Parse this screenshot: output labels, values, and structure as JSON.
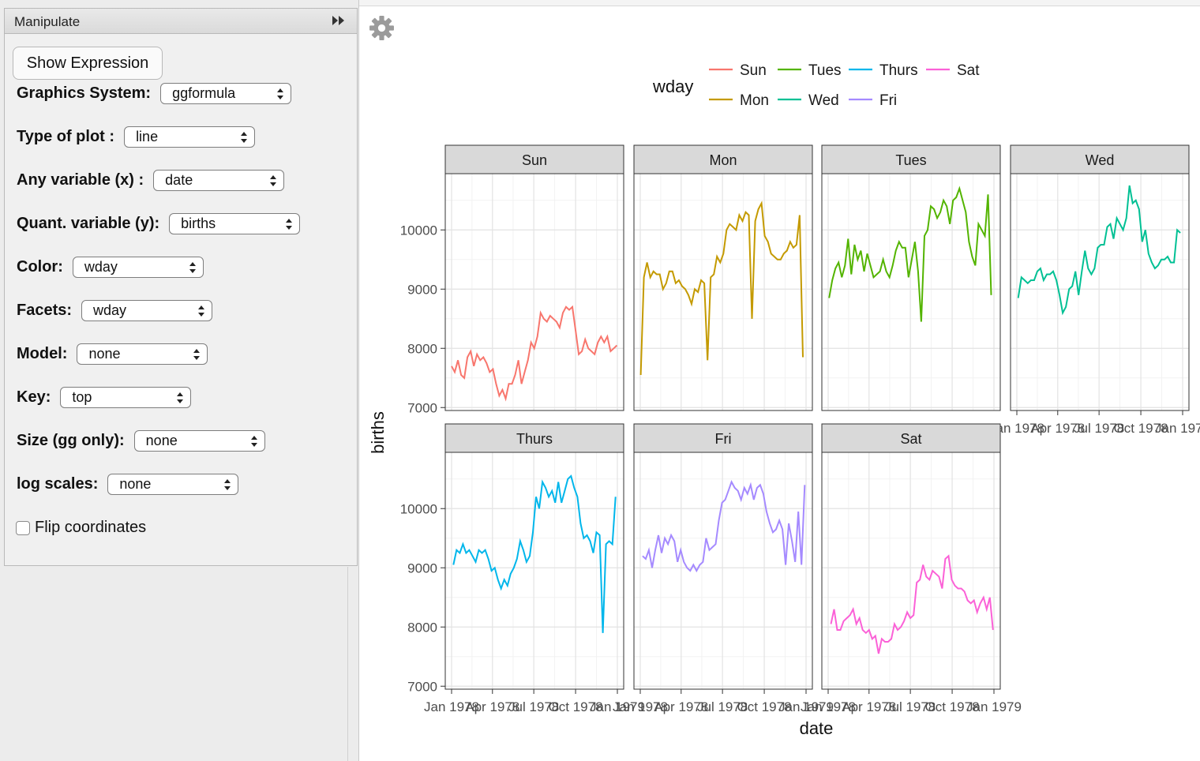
{
  "window": {
    "panel_title": "Manipulate"
  },
  "controls": {
    "show_expression_label": "Show Expression",
    "fields": [
      {
        "label": "Graphics System:",
        "value": "ggformula"
      },
      {
        "label": "Type of plot :",
        "value": "line"
      },
      {
        "label": "Any variable (x) :",
        "value": "date"
      },
      {
        "label": "Quant. variable (y):",
        "value": "births"
      },
      {
        "label": "Color:",
        "value": "wday"
      },
      {
        "label": "Facets:",
        "value": "wday"
      },
      {
        "label": "Model:",
        "value": "none"
      },
      {
        "label": "Key:",
        "value": "top"
      },
      {
        "label": "Size (gg only):",
        "value": "none"
      },
      {
        "label": "log scales:",
        "value": "none"
      }
    ],
    "flip_coordinates": {
      "label": "Flip coordinates",
      "checked": false
    }
  },
  "icons": {
    "settings": "gear-icon",
    "collapse": "double-chevron-right-icon"
  },
  "chart_data": {
    "type": "line",
    "facet_by": "wday",
    "facet_ncol": 4,
    "xlabel": "date",
    "ylabel": "births",
    "ylim": [
      6950,
      10950
    ],
    "yticks": [
      7000,
      8000,
      9000,
      10000
    ],
    "xlim": [
      "1978-01-01",
      "1979-01-01"
    ],
    "xticks": [
      {
        "date": "1978-01-01",
        "label": "Jan 1978"
      },
      {
        "date": "1978-04-01",
        "label": "Apr 1978"
      },
      {
        "date": "1978-07-01",
        "label": "Jul 1978"
      },
      {
        "date": "1978-10-01",
        "label": "Oct 1978"
      },
      {
        "date": "1979-01-01",
        "label": "Jan 1979"
      }
    ],
    "legend": {
      "title": "wday",
      "position": "top"
    },
    "grid": true,
    "series": [
      {
        "name": "Sun",
        "color": "#F8766D",
        "x": [
          "1978-01-01",
          "1978-01-08",
          "1978-01-15",
          "1978-01-22",
          "1978-01-29",
          "1978-02-05",
          "1978-02-12",
          "1978-02-19",
          "1978-02-26",
          "1978-03-05",
          "1978-03-12",
          "1978-03-19",
          "1978-03-26",
          "1978-04-02",
          "1978-04-09",
          "1978-04-16",
          "1978-04-23",
          "1978-04-30",
          "1978-05-07",
          "1978-05-14",
          "1978-05-21",
          "1978-05-28",
          "1978-06-04",
          "1978-06-11",
          "1978-06-18",
          "1978-06-25",
          "1978-07-02",
          "1978-07-09",
          "1978-07-16",
          "1978-07-23",
          "1978-07-30",
          "1978-08-06",
          "1978-08-13",
          "1978-08-20",
          "1978-08-27",
          "1978-09-03",
          "1978-09-10",
          "1978-09-17",
          "1978-09-24",
          "1978-10-01",
          "1978-10-08",
          "1978-10-15",
          "1978-10-22",
          "1978-10-29",
          "1978-11-05",
          "1978-11-12",
          "1978-11-19",
          "1978-11-26",
          "1978-12-03",
          "1978-12-10",
          "1978-12-17",
          "1978-12-24",
          "1978-12-31"
        ],
        "y": [
          7700,
          7600,
          7800,
          7550,
          7500,
          7850,
          7950,
          7700,
          7900,
          7800,
          7850,
          7750,
          7600,
          7650,
          7400,
          7200,
          7300,
          7150,
          7400,
          7400,
          7550,
          7800,
          7400,
          7600,
          7800,
          8100,
          8000,
          8200,
          8600,
          8500,
          8450,
          8550,
          8500,
          8450,
          8350,
          8600,
          8700,
          8650,
          8700,
          8300,
          7900,
          7950,
          8150,
          8000,
          7950,
          7900,
          8100,
          8200,
          8100,
          8200,
          7950,
          8000,
          8050
        ]
      },
      {
        "name": "Mon",
        "color": "#C49A00",
        "x": [
          "1978-01-02",
          "1978-01-09",
          "1978-01-16",
          "1978-01-23",
          "1978-01-30",
          "1978-02-06",
          "1978-02-13",
          "1978-02-20",
          "1978-02-27",
          "1978-03-06",
          "1978-03-13",
          "1978-03-20",
          "1978-03-27",
          "1978-04-03",
          "1978-04-10",
          "1978-04-17",
          "1978-04-24",
          "1978-05-01",
          "1978-05-08",
          "1978-05-15",
          "1978-05-22",
          "1978-05-29",
          "1978-06-05",
          "1978-06-12",
          "1978-06-19",
          "1978-06-26",
          "1978-07-03",
          "1978-07-10",
          "1978-07-17",
          "1978-07-24",
          "1978-07-31",
          "1978-08-07",
          "1978-08-14",
          "1978-08-21",
          "1978-08-28",
          "1978-09-04",
          "1978-09-11",
          "1978-09-18",
          "1978-09-25",
          "1978-10-02",
          "1978-10-09",
          "1978-10-16",
          "1978-10-23",
          "1978-10-30",
          "1978-11-06",
          "1978-11-13",
          "1978-11-20",
          "1978-11-27",
          "1978-12-04",
          "1978-12-11",
          "1978-12-18",
          "1978-12-25"
        ],
        "y": [
          7550,
          9200,
          9450,
          9200,
          9300,
          9250,
          9250,
          9000,
          9100,
          9300,
          9300,
          9100,
          9150,
          9050,
          9000,
          8900,
          8750,
          9000,
          8950,
          9150,
          9100,
          7800,
          9200,
          9250,
          9550,
          9450,
          9600,
          10000,
          10100,
          10050,
          10000,
          10250,
          10150,
          10300,
          10250,
          8500,
          10150,
          10350,
          10450,
          9900,
          9800,
          9600,
          9550,
          9500,
          9500,
          9600,
          9650,
          9800,
          9700,
          9750,
          10250,
          7850
        ]
      },
      {
        "name": "Tues",
        "color": "#53B400",
        "x": [
          "1978-01-03",
          "1978-01-10",
          "1978-01-17",
          "1978-01-24",
          "1978-01-31",
          "1978-02-07",
          "1978-02-14",
          "1978-02-21",
          "1978-02-28",
          "1978-03-07",
          "1978-03-14",
          "1978-03-21",
          "1978-03-28",
          "1978-04-04",
          "1978-04-11",
          "1978-04-18",
          "1978-04-25",
          "1978-05-02",
          "1978-05-09",
          "1978-05-16",
          "1978-05-23",
          "1978-05-30",
          "1978-06-06",
          "1978-06-13",
          "1978-06-20",
          "1978-06-27",
          "1978-07-04",
          "1978-07-11",
          "1978-07-18",
          "1978-07-25",
          "1978-08-01",
          "1978-08-08",
          "1978-08-15",
          "1978-08-22",
          "1978-08-29",
          "1978-09-05",
          "1978-09-12",
          "1978-09-19",
          "1978-09-26",
          "1978-10-03",
          "1978-10-10",
          "1978-10-17",
          "1978-10-24",
          "1978-10-31",
          "1978-11-07",
          "1978-11-14",
          "1978-11-21",
          "1978-11-28",
          "1978-12-05",
          "1978-12-12",
          "1978-12-19",
          "1978-12-26"
        ],
        "y": [
          8850,
          9150,
          9350,
          9450,
          9200,
          9400,
          9850,
          9250,
          9750,
          9500,
          9650,
          9300,
          9600,
          9400,
          9200,
          9250,
          9300,
          9500,
          9300,
          9200,
          9400,
          9650,
          9800,
          9700,
          9700,
          9200,
          9500,
          9800,
          9300,
          8450,
          9900,
          10000,
          10400,
          10350,
          10200,
          10300,
          10500,
          10400,
          10100,
          10500,
          10550,
          10700,
          10500,
          10300,
          9800,
          9550,
          9400,
          10100,
          10000,
          9900,
          10600,
          8900
        ]
      },
      {
        "name": "Wed",
        "color": "#00C094",
        "x": [
          "1978-01-04",
          "1978-01-11",
          "1978-01-18",
          "1978-01-25",
          "1978-02-01",
          "1978-02-08",
          "1978-02-15",
          "1978-02-22",
          "1978-03-01",
          "1978-03-08",
          "1978-03-15",
          "1978-03-22",
          "1978-03-29",
          "1978-04-05",
          "1978-04-12",
          "1978-04-19",
          "1978-04-26",
          "1978-05-03",
          "1978-05-10",
          "1978-05-17",
          "1978-05-24",
          "1978-05-31",
          "1978-06-07",
          "1978-06-14",
          "1978-06-21",
          "1978-06-28",
          "1978-07-05",
          "1978-07-12",
          "1978-07-19",
          "1978-07-26",
          "1978-08-02",
          "1978-08-09",
          "1978-08-16",
          "1978-08-23",
          "1978-08-30",
          "1978-09-06",
          "1978-09-13",
          "1978-09-20",
          "1978-09-27",
          "1978-10-04",
          "1978-10-11",
          "1978-10-18",
          "1978-10-25",
          "1978-11-01",
          "1978-11-08",
          "1978-11-15",
          "1978-11-22",
          "1978-11-29",
          "1978-12-06",
          "1978-12-13",
          "1978-12-20",
          "1978-12-27"
        ],
        "y": [
          8850,
          9200,
          9150,
          9100,
          9150,
          9150,
          9300,
          9350,
          9150,
          9250,
          9250,
          9300,
          9150,
          8900,
          8600,
          8700,
          9000,
          9050,
          9300,
          8900,
          9300,
          9650,
          9350,
          9250,
          9350,
          9700,
          9750,
          9750,
          10050,
          10100,
          9850,
          10200,
          10100,
          10000,
          10200,
          10750,
          10450,
          10500,
          10350,
          9800,
          10000,
          9600,
          9450,
          9350,
          9400,
          9500,
          9500,
          9550,
          9450,
          9450,
          10000,
          9950
        ]
      },
      {
        "name": "Thurs",
        "color": "#00B6EB",
        "x": [
          "1978-01-05",
          "1978-01-12",
          "1978-01-19",
          "1978-01-26",
          "1978-02-02",
          "1978-02-09",
          "1978-02-16",
          "1978-02-23",
          "1978-03-02",
          "1978-03-09",
          "1978-03-16",
          "1978-03-23",
          "1978-03-30",
          "1978-04-06",
          "1978-04-13",
          "1978-04-20",
          "1978-04-27",
          "1978-05-04",
          "1978-05-11",
          "1978-05-18",
          "1978-05-25",
          "1978-06-01",
          "1978-06-08",
          "1978-06-15",
          "1978-06-22",
          "1978-06-29",
          "1978-07-06",
          "1978-07-13",
          "1978-07-20",
          "1978-07-27",
          "1978-08-03",
          "1978-08-10",
          "1978-08-17",
          "1978-08-24",
          "1978-08-31",
          "1978-09-07",
          "1978-09-14",
          "1978-09-21",
          "1978-09-28",
          "1978-10-05",
          "1978-10-12",
          "1978-10-19",
          "1978-10-26",
          "1978-11-02",
          "1978-11-09",
          "1978-11-16",
          "1978-11-23",
          "1978-11-30",
          "1978-12-07",
          "1978-12-14",
          "1978-12-21",
          "1978-12-28"
        ],
        "y": [
          9050,
          9300,
          9250,
          9400,
          9250,
          9300,
          9200,
          9100,
          9300,
          9250,
          9300,
          9150,
          8950,
          9000,
          8800,
          8650,
          8800,
          8700,
          8900,
          9000,
          9150,
          9450,
          9300,
          9100,
          9200,
          9600,
          10200,
          10000,
          10450,
          10350,
          10200,
          10300,
          10100,
          10450,
          10100,
          10300,
          10500,
          10550,
          10350,
          10200,
          9750,
          9500,
          9550,
          9450,
          9250,
          9600,
          9550,
          7900,
          9400,
          9450,
          9400,
          10200
        ]
      },
      {
        "name": "Fri",
        "color": "#A58AFF",
        "x": [
          "1978-01-06",
          "1978-01-13",
          "1978-01-20",
          "1978-01-27",
          "1978-02-03",
          "1978-02-10",
          "1978-02-17",
          "1978-02-24",
          "1978-03-03",
          "1978-03-10",
          "1978-03-17",
          "1978-03-24",
          "1978-03-31",
          "1978-04-07",
          "1978-04-14",
          "1978-04-21",
          "1978-04-28",
          "1978-05-05",
          "1978-05-12",
          "1978-05-19",
          "1978-05-26",
          "1978-06-02",
          "1978-06-09",
          "1978-06-16",
          "1978-06-23",
          "1978-06-30",
          "1978-07-07",
          "1978-07-14",
          "1978-07-21",
          "1978-07-28",
          "1978-08-04",
          "1978-08-11",
          "1978-08-18",
          "1978-08-25",
          "1978-09-01",
          "1978-09-08",
          "1978-09-15",
          "1978-09-22",
          "1978-09-29",
          "1978-10-06",
          "1978-10-13",
          "1978-10-20",
          "1978-10-27",
          "1978-11-03",
          "1978-11-10",
          "1978-11-17",
          "1978-11-24",
          "1978-12-01",
          "1978-12-08",
          "1978-12-15",
          "1978-12-22",
          "1978-12-29"
        ],
        "y": [
          9200,
          9150,
          9300,
          9000,
          9300,
          9550,
          9250,
          9500,
          9400,
          9550,
          9450,
          9100,
          9300,
          9100,
          9000,
          8950,
          9050,
          8950,
          9050,
          9100,
          9500,
          9300,
          9350,
          9400,
          9800,
          10100,
          10150,
          10300,
          10450,
          10350,
          10300,
          10150,
          10350,
          10250,
          10400,
          10150,
          10350,
          10400,
          10250,
          9950,
          9750,
          9600,
          9650,
          9800,
          9650,
          9050,
          9750,
          9450,
          9100,
          9950,
          9050,
          10400
        ]
      },
      {
        "name": "Sat",
        "color": "#FB61D7",
        "x": [
          "1978-01-07",
          "1978-01-14",
          "1978-01-21",
          "1978-01-28",
          "1978-02-04",
          "1978-02-11",
          "1978-02-18",
          "1978-02-25",
          "1978-03-04",
          "1978-03-11",
          "1978-03-18",
          "1978-03-25",
          "1978-04-01",
          "1978-04-08",
          "1978-04-15",
          "1978-04-22",
          "1978-04-29",
          "1978-05-06",
          "1978-05-13",
          "1978-05-20",
          "1978-05-27",
          "1978-06-03",
          "1978-06-10",
          "1978-06-17",
          "1978-06-24",
          "1978-07-01",
          "1978-07-08",
          "1978-07-15",
          "1978-07-22",
          "1978-07-29",
          "1978-08-05",
          "1978-08-12",
          "1978-08-19",
          "1978-08-26",
          "1978-09-02",
          "1978-09-09",
          "1978-09-16",
          "1978-09-23",
          "1978-09-30",
          "1978-10-07",
          "1978-10-14",
          "1978-10-21",
          "1978-10-28",
          "1978-11-04",
          "1978-11-11",
          "1978-11-18",
          "1978-11-25",
          "1978-12-02",
          "1978-12-09",
          "1978-12-16",
          "1978-12-23",
          "1978-12-30"
        ],
        "y": [
          8050,
          8300,
          7950,
          7950,
          8100,
          8150,
          8200,
          8300,
          8050,
          8150,
          7950,
          7900,
          7950,
          7800,
          7850,
          7550,
          7800,
          7750,
          7750,
          7800,
          8050,
          7950,
          8000,
          8100,
          8250,
          8150,
          8200,
          8750,
          8800,
          9050,
          8850,
          8800,
          8950,
          8900,
          8850,
          8650,
          9150,
          9200,
          8800,
          8700,
          8650,
          8650,
          8600,
          8450,
          8400,
          8450,
          8250,
          8400,
          8500,
          8300,
          8500,
          7950
        ]
      }
    ]
  }
}
